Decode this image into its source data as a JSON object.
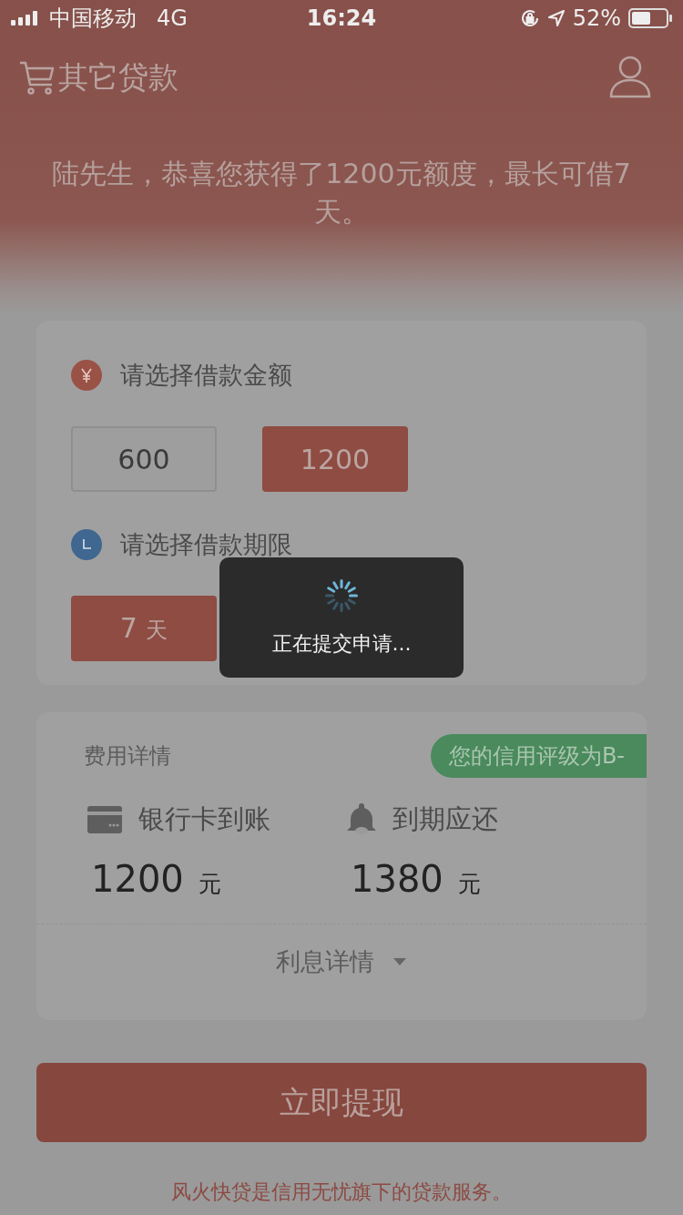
{
  "status_bar": {
    "carrier": "中国移动",
    "network": "4G",
    "time": "16:24",
    "battery": "52%"
  },
  "header": {
    "title": "其它贷款"
  },
  "greeting": "陆先生，恭喜您获得了1200元额度，最长可借7天。",
  "amount": {
    "label": "请选择借款金额",
    "options": [
      {
        "label": "600",
        "selected": false
      },
      {
        "label": "1200",
        "selected": true
      }
    ]
  },
  "term": {
    "label": "请选择借款期限",
    "options": [
      {
        "value": "7",
        "unit": "天",
        "selected": true
      }
    ]
  },
  "fees": {
    "title": "费用详情",
    "badge": "您的信用评级为B-",
    "items": [
      {
        "kind": "card",
        "label": "银行卡到账",
        "amount": "1200",
        "unit": "元"
      },
      {
        "kind": "bell",
        "label": "到期应还",
        "amount": "1380",
        "unit": "元"
      }
    ],
    "details": "利息详情"
  },
  "submit": "立即提现",
  "footer": "风火快贷是信用无忧旗下的贷款服务。",
  "toast": {
    "text": "正在提交申请..."
  }
}
